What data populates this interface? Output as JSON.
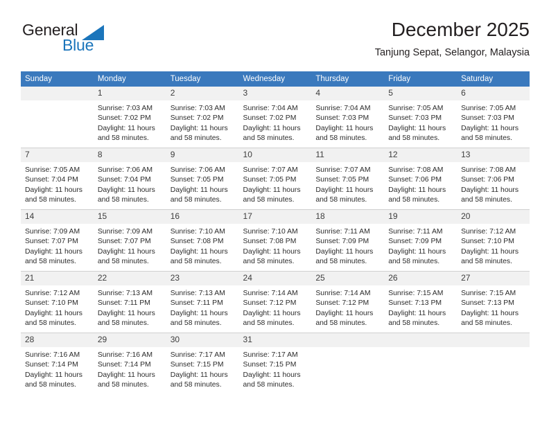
{
  "logo": {
    "word1": "General",
    "word2": "Blue",
    "triangle_color": "#1b75bb",
    "text_color": "#231f20"
  },
  "header": {
    "title": "December 2025",
    "subtitle": "Tanjung Sepat, Selangor, Malaysia",
    "accent_color": "#3a79bd"
  },
  "calendar": {
    "weekday_headers": [
      "Sunday",
      "Monday",
      "Tuesday",
      "Wednesday",
      "Thursday",
      "Friday",
      "Saturday"
    ],
    "header_bg": "#3a79bd",
    "daynum_bg": "#f1f1f1",
    "weeks": [
      [
        {
          "day": "",
          "sunrise": "",
          "sunset": "",
          "daylight1": "",
          "daylight2": ""
        },
        {
          "day": "1",
          "sunrise": "Sunrise: 7:03 AM",
          "sunset": "Sunset: 7:02 PM",
          "daylight1": "Daylight: 11 hours",
          "daylight2": "and 58 minutes."
        },
        {
          "day": "2",
          "sunrise": "Sunrise: 7:03 AM",
          "sunset": "Sunset: 7:02 PM",
          "daylight1": "Daylight: 11 hours",
          "daylight2": "and 58 minutes."
        },
        {
          "day": "3",
          "sunrise": "Sunrise: 7:04 AM",
          "sunset": "Sunset: 7:02 PM",
          "daylight1": "Daylight: 11 hours",
          "daylight2": "and 58 minutes."
        },
        {
          "day": "4",
          "sunrise": "Sunrise: 7:04 AM",
          "sunset": "Sunset: 7:03 PM",
          "daylight1": "Daylight: 11 hours",
          "daylight2": "and 58 minutes."
        },
        {
          "day": "5",
          "sunrise": "Sunrise: 7:05 AM",
          "sunset": "Sunset: 7:03 PM",
          "daylight1": "Daylight: 11 hours",
          "daylight2": "and 58 minutes."
        },
        {
          "day": "6",
          "sunrise": "Sunrise: 7:05 AM",
          "sunset": "Sunset: 7:03 PM",
          "daylight1": "Daylight: 11 hours",
          "daylight2": "and 58 minutes."
        }
      ],
      [
        {
          "day": "7",
          "sunrise": "Sunrise: 7:05 AM",
          "sunset": "Sunset: 7:04 PM",
          "daylight1": "Daylight: 11 hours",
          "daylight2": "and 58 minutes."
        },
        {
          "day": "8",
          "sunrise": "Sunrise: 7:06 AM",
          "sunset": "Sunset: 7:04 PM",
          "daylight1": "Daylight: 11 hours",
          "daylight2": "and 58 minutes."
        },
        {
          "day": "9",
          "sunrise": "Sunrise: 7:06 AM",
          "sunset": "Sunset: 7:05 PM",
          "daylight1": "Daylight: 11 hours",
          "daylight2": "and 58 minutes."
        },
        {
          "day": "10",
          "sunrise": "Sunrise: 7:07 AM",
          "sunset": "Sunset: 7:05 PM",
          "daylight1": "Daylight: 11 hours",
          "daylight2": "and 58 minutes."
        },
        {
          "day": "11",
          "sunrise": "Sunrise: 7:07 AM",
          "sunset": "Sunset: 7:05 PM",
          "daylight1": "Daylight: 11 hours",
          "daylight2": "and 58 minutes."
        },
        {
          "day": "12",
          "sunrise": "Sunrise: 7:08 AM",
          "sunset": "Sunset: 7:06 PM",
          "daylight1": "Daylight: 11 hours",
          "daylight2": "and 58 minutes."
        },
        {
          "day": "13",
          "sunrise": "Sunrise: 7:08 AM",
          "sunset": "Sunset: 7:06 PM",
          "daylight1": "Daylight: 11 hours",
          "daylight2": "and 58 minutes."
        }
      ],
      [
        {
          "day": "14",
          "sunrise": "Sunrise: 7:09 AM",
          "sunset": "Sunset: 7:07 PM",
          "daylight1": "Daylight: 11 hours",
          "daylight2": "and 58 minutes."
        },
        {
          "day": "15",
          "sunrise": "Sunrise: 7:09 AM",
          "sunset": "Sunset: 7:07 PM",
          "daylight1": "Daylight: 11 hours",
          "daylight2": "and 58 minutes."
        },
        {
          "day": "16",
          "sunrise": "Sunrise: 7:10 AM",
          "sunset": "Sunset: 7:08 PM",
          "daylight1": "Daylight: 11 hours",
          "daylight2": "and 58 minutes."
        },
        {
          "day": "17",
          "sunrise": "Sunrise: 7:10 AM",
          "sunset": "Sunset: 7:08 PM",
          "daylight1": "Daylight: 11 hours",
          "daylight2": "and 58 minutes."
        },
        {
          "day": "18",
          "sunrise": "Sunrise: 7:11 AM",
          "sunset": "Sunset: 7:09 PM",
          "daylight1": "Daylight: 11 hours",
          "daylight2": "and 58 minutes."
        },
        {
          "day": "19",
          "sunrise": "Sunrise: 7:11 AM",
          "sunset": "Sunset: 7:09 PM",
          "daylight1": "Daylight: 11 hours",
          "daylight2": "and 58 minutes."
        },
        {
          "day": "20",
          "sunrise": "Sunrise: 7:12 AM",
          "sunset": "Sunset: 7:10 PM",
          "daylight1": "Daylight: 11 hours",
          "daylight2": "and 58 minutes."
        }
      ],
      [
        {
          "day": "21",
          "sunrise": "Sunrise: 7:12 AM",
          "sunset": "Sunset: 7:10 PM",
          "daylight1": "Daylight: 11 hours",
          "daylight2": "and 58 minutes."
        },
        {
          "day": "22",
          "sunrise": "Sunrise: 7:13 AM",
          "sunset": "Sunset: 7:11 PM",
          "daylight1": "Daylight: 11 hours",
          "daylight2": "and 58 minutes."
        },
        {
          "day": "23",
          "sunrise": "Sunrise: 7:13 AM",
          "sunset": "Sunset: 7:11 PM",
          "daylight1": "Daylight: 11 hours",
          "daylight2": "and 58 minutes."
        },
        {
          "day": "24",
          "sunrise": "Sunrise: 7:14 AM",
          "sunset": "Sunset: 7:12 PM",
          "daylight1": "Daylight: 11 hours",
          "daylight2": "and 58 minutes."
        },
        {
          "day": "25",
          "sunrise": "Sunrise: 7:14 AM",
          "sunset": "Sunset: 7:12 PM",
          "daylight1": "Daylight: 11 hours",
          "daylight2": "and 58 minutes."
        },
        {
          "day": "26",
          "sunrise": "Sunrise: 7:15 AM",
          "sunset": "Sunset: 7:13 PM",
          "daylight1": "Daylight: 11 hours",
          "daylight2": "and 58 minutes."
        },
        {
          "day": "27",
          "sunrise": "Sunrise: 7:15 AM",
          "sunset": "Sunset: 7:13 PM",
          "daylight1": "Daylight: 11 hours",
          "daylight2": "and 58 minutes."
        }
      ],
      [
        {
          "day": "28",
          "sunrise": "Sunrise: 7:16 AM",
          "sunset": "Sunset: 7:14 PM",
          "daylight1": "Daylight: 11 hours",
          "daylight2": "and 58 minutes."
        },
        {
          "day": "29",
          "sunrise": "Sunrise: 7:16 AM",
          "sunset": "Sunset: 7:14 PM",
          "daylight1": "Daylight: 11 hours",
          "daylight2": "and 58 minutes."
        },
        {
          "day": "30",
          "sunrise": "Sunrise: 7:17 AM",
          "sunset": "Sunset: 7:15 PM",
          "daylight1": "Daylight: 11 hours",
          "daylight2": "and 58 minutes."
        },
        {
          "day": "31",
          "sunrise": "Sunrise: 7:17 AM",
          "sunset": "Sunset: 7:15 PM",
          "daylight1": "Daylight: 11 hours",
          "daylight2": "and 58 minutes."
        },
        {
          "day": "",
          "sunrise": "",
          "sunset": "",
          "daylight1": "",
          "daylight2": ""
        },
        {
          "day": "",
          "sunrise": "",
          "sunset": "",
          "daylight1": "",
          "daylight2": ""
        },
        {
          "day": "",
          "sunrise": "",
          "sunset": "",
          "daylight1": "",
          "daylight2": ""
        }
      ]
    ]
  }
}
